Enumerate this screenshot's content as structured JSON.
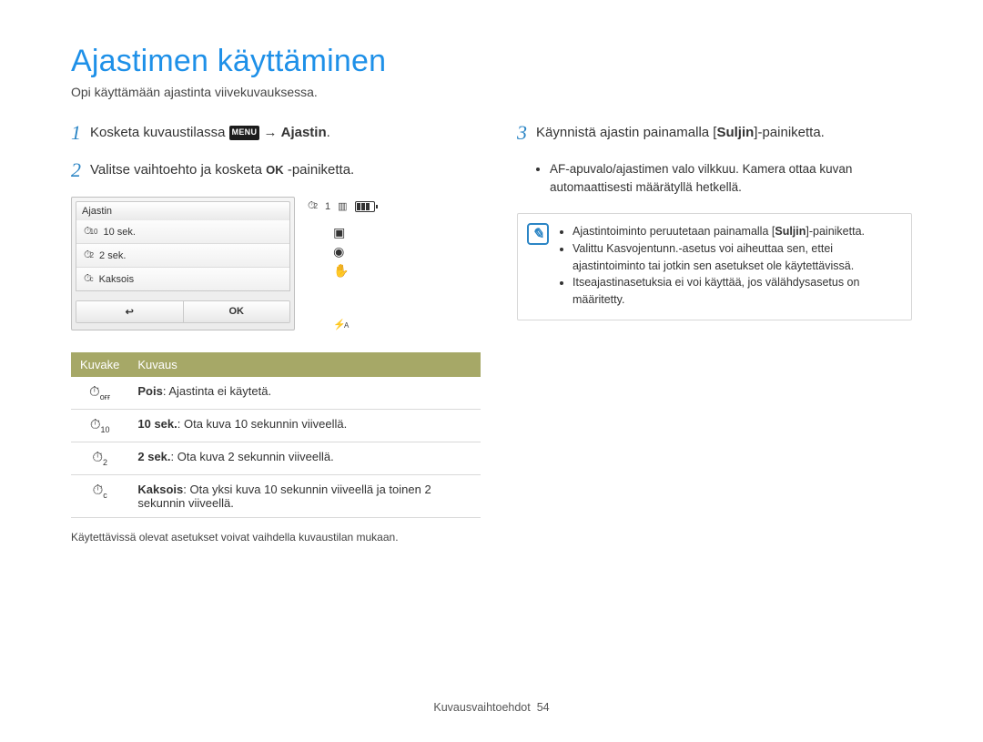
{
  "title": "Ajastimen käyttäminen",
  "subtitle": "Opi käyttämään ajastinta viivekuvauksessa.",
  "step1": {
    "num": "1",
    "pre": "Kosketa kuvaustilassa ",
    "menu": "MENU",
    "arrow": " → ",
    "target": "Ajastin",
    "post": "."
  },
  "step2": {
    "num": "2",
    "pre": "Valitse vaihtoehto ja kosketa ",
    "ok": "OK",
    "post": " -painiketta."
  },
  "lcd": {
    "title": "Ajastin",
    "opt1": "10 sek.",
    "opt2": "2 sek.",
    "opt3": "Kaksois",
    "btn_back": "↩",
    "btn_ok": "OK",
    "side_timer": "⏱",
    "side_sub": "2",
    "side_one": "1",
    "flash": "⚡",
    "flash_sub": "A"
  },
  "table": {
    "h1": "Kuvake",
    "h2": "Kuvaus",
    "r1b": "Pois",
    "r1t": ": Ajastinta ei käytetä.",
    "r2b": "10 sek.",
    "r2t": ": Ota kuva 10 sekunnin viiveellä.",
    "r3b": "2 sek.",
    "r3t": ": Ota kuva 2 sekunnin viiveellä.",
    "r4b": "Kaksois",
    "r4t": ": Ota yksi kuva 10 sekunnin viiveellä ja toinen 2 sekunnin viiveellä."
  },
  "footnote": "Käytettävissä olevat asetukset voivat vaihdella kuvaustilan mukaan.",
  "step3": {
    "num": "3",
    "pre": "Käynnistä ajastin painamalla [",
    "btn": "Suljin",
    "post": "]-painiketta.",
    "bullet1": "AF-apuvalo/ajastimen valo vilkkuu. Kamera ottaa kuvan automaattisesti määrätyllä hetkellä."
  },
  "info": {
    "l1a": "Ajastintoiminto peruutetaan painamalla [",
    "l1b": "Suljin",
    "l1c": "]-painiketta.",
    "l2": "Valittu Kasvojentunn.-asetus voi aiheuttaa sen, ettei ajastintoiminto tai jotkin sen asetukset ole käytettävissä.",
    "l3": "Itseajastinasetuksia ei voi käyttää, jos välähdysasetus on määritetty."
  },
  "pagefoot_label": "Kuvausvaihtoehdot",
  "pagefoot_num": "54"
}
